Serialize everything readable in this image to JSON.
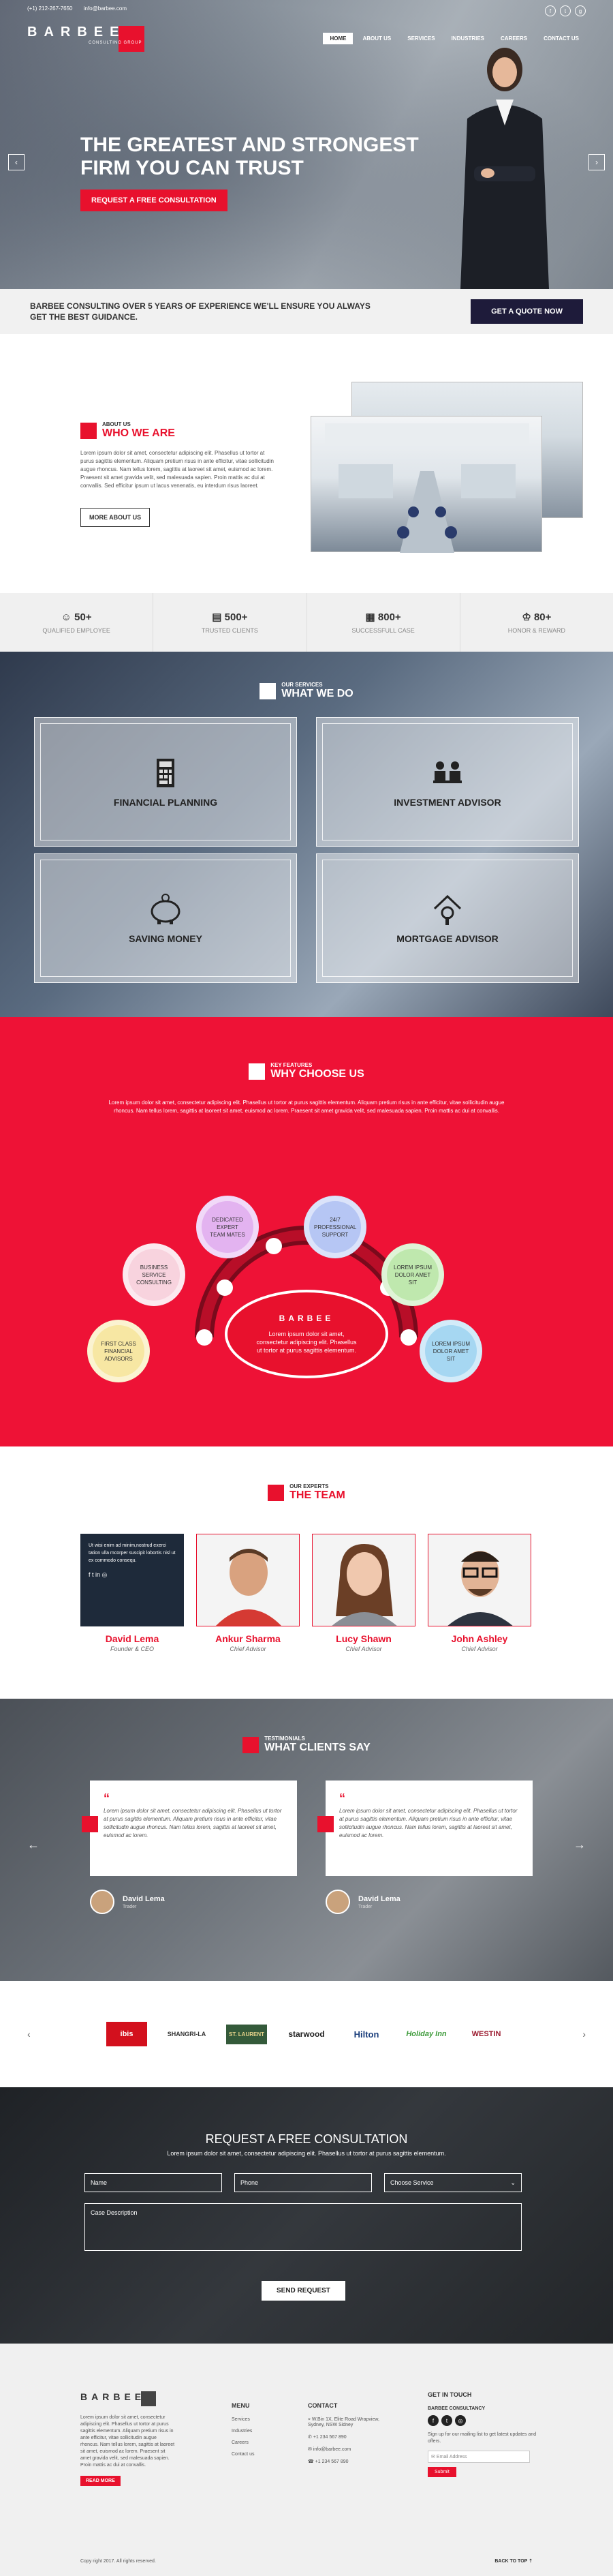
{
  "topbar": {
    "phone": "(+1) 212-267-7650",
    "email": "info@barbee.com"
  },
  "brand": {
    "name": "BARBEE",
    "tagline": "CONSULTING GROUP"
  },
  "nav": [
    "HOME",
    "ABOUT US",
    "SERVICES",
    "INDUSTRIES",
    "CAREERS",
    "CONTACT US"
  ],
  "hero": {
    "line1": "THE GREATEST AND STRONGEST",
    "line2": "FIRM YOU CAN TRUST",
    "cta": "REQUEST A FREE CONSULTATION"
  },
  "strip": {
    "text": "BARBEE CONSULTING OVER 5 YEARS OF EXPERIENCE WE'LL ENSURE YOU ALWAYS GET THE BEST GUIDANCE.",
    "button": "GET A QUOTE NOW"
  },
  "who": {
    "small": "ABOUT US",
    "big": "WHO WE ARE",
    "body": "Lorem ipsum dolor sit amet, consectetur adipiscing elit. Phasellus ut tortor at purus sagittis elementum. Aliquam pretium risus in ante efficitur, vitae sollicitudin augue rhoncus. Nam tellus lorem, sagittis at laoreet sit amet, euismod ac lorem. Praesent sit amet gravida velit, sed malesuada sapien. Proin mattis ac dui at convallis. Sed efficitur ipsum ut lacus venenatis, eu interdum risus laoreet.",
    "button": "MORE ABOUT US"
  },
  "stats": [
    {
      "num": "50+",
      "label": "QUALIFIED EMPLOYEE"
    },
    {
      "num": "500+",
      "label": "TRUSTED CLIENTS"
    },
    {
      "num": "800+",
      "label": "SUCCESSFULL CASE"
    },
    {
      "num": "80+",
      "label": "HONOR & REWARD"
    }
  ],
  "services": {
    "small": "OUR SERVICES",
    "big": "WHAT WE DO",
    "items": [
      "FINANCIAL PLANNING",
      "INVESTMENT ADVISOR",
      "SAVING MONEY",
      "MORTGAGE ADVISOR"
    ]
  },
  "why": {
    "small": "KEY FEATURES",
    "big": "WHY CHOOSE US",
    "intro": "Lorem ipsum dolor sit amet, consectetur adipiscing elit. Phasellus ut tortor at purus sagittis elementum. Aliquam pretium risus in ante efficitur, vitae sollicitudin augue rhoncus. Nam tellus lorem, sagittis at laoreet sit amet, euismod ac lorem. Praesent sit amet gravida velit, sed malesuada sapien. Proin mattis ac dui at convallis.",
    "bubbles": [
      "FIRST CLASS FINANCIAL ADVISORS",
      "BUSINESS SERVICE CONSULTING",
      "DEDICATED EXPERT TEAM MATES",
      "24/7 PROFESSIONAL SUPPORT",
      "LOREM IPSUM DOLOR AMET SIT",
      "LOREM IPSUM DOLOR AMET SIT"
    ],
    "center_text": "Lorem ipsum dolor sit amet, consectetur adipiscing elit. Phasellus ut tortor at purus sagittis elementum."
  },
  "team": {
    "small": "OUR EXPERTS",
    "big": "THE TEAM",
    "card_text": "Ut wisi enim ad minim,nostrud exerci tation ulla mcorper suscipit lobortis nisl ut ex commodo consequ.",
    "members": [
      {
        "name": "David Lema",
        "role": "Founder & CEO"
      },
      {
        "name": "Ankur Sharma",
        "role": "Chief Advisor"
      },
      {
        "name": "Lucy Shawn",
        "role": "Chief Advisor"
      },
      {
        "name": "John Ashley",
        "role": "Chief Advisor"
      }
    ]
  },
  "testimonials": {
    "small": "TESTIMONIALS",
    "big": "WHAT CLIENTS SAY",
    "quote": "Lorem ipsum dolor sit amet, consectetur adipiscing elit. Phasellus ut tortor at purus sagittis elementum. Aliquam pretium risus in ante efficitur, vitae sollicitudin augue rhoncus. Nam tellus lorem, sagittis at laoreet sit amet, euismod ac lorem.",
    "author": "David Lema",
    "author_role": "Trader"
  },
  "clients": [
    "ibis",
    "SHANGRI-LA",
    "ST. LAURENT",
    "starwood",
    "Hilton",
    "Holiday Inn",
    "WESTIN"
  ],
  "form": {
    "title": "REQUEST A FREE CONSULTATION",
    "sub": "Lorem ipsum dolor sit amet, consectetur adipiscing elit. Phasellus ut tortor at purus sagittis elementum.",
    "name": "Name",
    "phone": "Phone",
    "service": "Choose Service",
    "desc": "Case Description",
    "button": "SEND REQUEST"
  },
  "footer": {
    "about": "Lorem ipsum dolor sit amet, consectetur adipiscing elit. Phasellus ut tortor at purus sagittis elementum. Aliquam pretium risus in ante efficitur, vitae sollicitudin augue rhoncus. Nam tellus lorem, sagittis at laoreet sit amet, euismod ac lorem. Praesent sit amet gravida velit, sed malesuada sapien. Proin mattis ac dui at convallis.",
    "read_more": "READ MORE",
    "menu_title": "MENU",
    "menu": [
      "Services",
      "Industries",
      "Careers",
      "Contact us"
    ],
    "contact_title": "CONTACT",
    "contact": [
      "W.Bin 1X, Elite Road Wrapview, Sydney, NSW Sidney",
      "+1 234 567 890",
      "info@barbee.com",
      "+1 234 567 890"
    ],
    "touch_title": "GET IN TOUCH",
    "touch_brand": "BARBEE CONSULTANCY",
    "touch_text": "Sign up for our mailing list to get latest updates and offers.",
    "email_placeholder": "Email Address",
    "submit": "Submit",
    "copy": "Copy right 2017. All rights reserved.",
    "back_top": "BACK TO TOP"
  }
}
